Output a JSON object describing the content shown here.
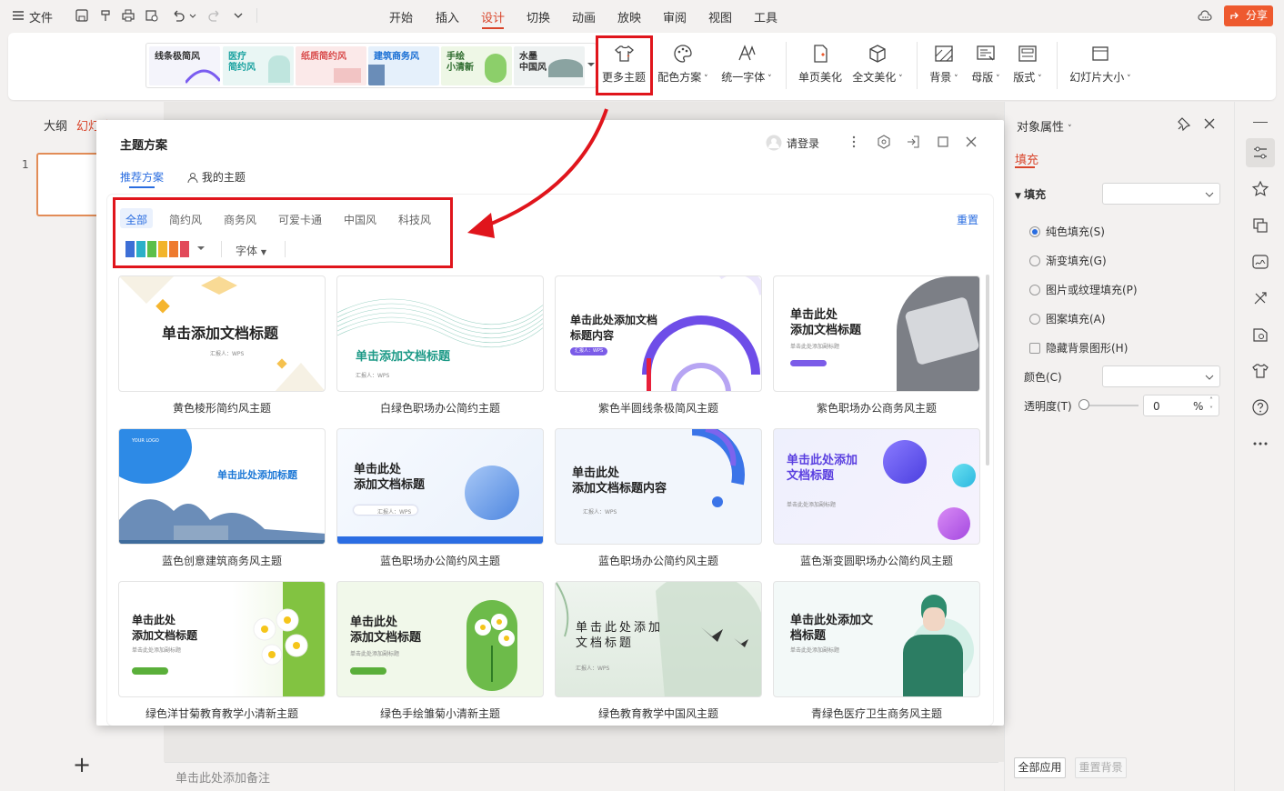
{
  "menubar": {
    "file_label": "文件",
    "tabs": [
      "开始",
      "插入",
      "设计",
      "切换",
      "动画",
      "放映",
      "审阅",
      "视图",
      "工具"
    ],
    "active_tab": "设计",
    "share_label": "分享"
  },
  "ribbon": {
    "theme_thumbs": [
      {
        "label": "线条极简风",
        "bg": "#f4f4fb",
        "color": "#333"
      },
      {
        "label": "医疗\n简约风",
        "bg": "#e9f6f4",
        "color": "#1aa2a0"
      },
      {
        "label": "纸质简约风",
        "bg": "#fbe9e9",
        "color": "#d94c4c"
      },
      {
        "label": "建筑商务风",
        "bg": "#e5f0fb",
        "color": "#1a6fd4"
      },
      {
        "label": "手绘\n小清新",
        "bg": "#eef7e6",
        "color": "#2b6a2b"
      },
      {
        "label": "水墨\n中国风",
        "bg": "#eef2f2",
        "color": "#333"
      }
    ],
    "buttons": {
      "more_themes": "更多主题",
      "color_scheme": "配色方案",
      "unify_font": "统一字体",
      "page_beautify": "单页美化",
      "full_beautify": "全文美化",
      "background": "背景",
      "master": "母版",
      "layout": "版式",
      "slide_size": "幻灯片大小"
    }
  },
  "left_pane": {
    "outline_tab": "大纲",
    "slides_tab": "幻灯片",
    "slide_number": "1",
    "add_label": "+"
  },
  "dialog": {
    "title": "主题方案",
    "login_label": "请登录",
    "tabs": [
      "推荐方案",
      "我的主题"
    ],
    "categories": [
      "全部",
      "简约风",
      "商务风",
      "可爱卡通",
      "中国风",
      "科技风"
    ],
    "active_category": "全部",
    "font_filter": "字体",
    "reset_label": "重置",
    "palette_colors": [
      "#3d6fd6",
      "#2bb0c8",
      "#5cbf4a",
      "#f2b42a",
      "#ee7a2f",
      "#e24a5a"
    ],
    "themes": [
      {
        "title": "单击添加文档标题",
        "sub": "汇报人：WPS",
        "caption": "黄色棱形简约风主题"
      },
      {
        "title": "单击添加文档标题",
        "sub": "汇报人：WPS",
        "caption": "白绿色职场办公简约主题"
      },
      {
        "title": "单击此处添加文档\n标题内容",
        "sub": "汇报人：WPS",
        "caption": "紫色半圆线条极简风主题"
      },
      {
        "title": "单击此处\n添加文档标题",
        "sub": "单击此处添加副标题",
        "caption": "紫色职场办公商务风主题"
      },
      {
        "title": "单击此处添加标题",
        "sub": "YOUR LOGO",
        "caption": "蓝色创意建筑商务风主题"
      },
      {
        "title": "单击此处\n添加文档标题",
        "sub": "汇报人：WPS",
        "caption": "蓝色职场办公简约风主题"
      },
      {
        "title": "单击此处\n添加文档标题内容",
        "sub": "汇报人：WPS",
        "caption": "蓝色职场办公简约风主题"
      },
      {
        "title": "单击此处添加\n文档标题",
        "sub": "单击此处添加副标题",
        "caption": "蓝色渐变圆职场办公简约风主题"
      },
      {
        "title": "单击此处\n添加文档标题",
        "sub": "单击此处添加副标题",
        "caption": "绿色洋甘菊教育教学小清新主题"
      },
      {
        "title": "单击此处\n添加文档标题",
        "sub": "单击此处添加副标题",
        "caption": "绿色手绘雏菊小清新主题"
      },
      {
        "title": "单击此处添加\n文档标题",
        "sub": "汇报人：WPS",
        "caption": "绿色教育教学中国风主题"
      },
      {
        "title": "单击此处添加文\n档标题",
        "sub": "单击此处添加副标题",
        "caption": "青绿色医疗卫生商务风主题"
      }
    ]
  },
  "props": {
    "header": "对象属性",
    "fill_tab": "填充",
    "fill_section": "填充",
    "options": [
      "纯色填充(S)",
      "渐变填充(G)",
      "图片或纹理填充(P)",
      "图案填充(A)"
    ],
    "selected_option": "纯色填充(S)",
    "hide_bg": "隐藏背景图形(H)",
    "color_label": "颜色(C)",
    "transparency_label": "透明度(T)",
    "transparency_value": "0",
    "percent": "%",
    "apply_all": "全部应用",
    "reset_bg": "重置背景"
  },
  "notes_placeholder": "单击此处添加备注",
  "accent_color": "#d9452b",
  "highlight_color": "#e0151c"
}
